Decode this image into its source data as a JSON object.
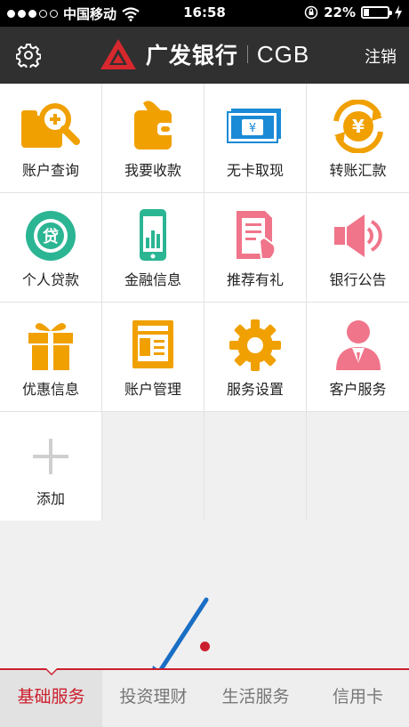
{
  "status": {
    "carrier": "中国移动",
    "time": "16:58",
    "battery": "22%",
    "battery_level": 0.22
  },
  "header": {
    "brand_cn": "广发银行",
    "brand_en": "CGB",
    "logout": "注销",
    "settings_icon": "gear-icon"
  },
  "grid": {
    "items": [
      {
        "label": "账户查询",
        "icon": "account-search-icon"
      },
      {
        "label": "我要收款",
        "icon": "wallet-icon"
      },
      {
        "label": "无卡取现",
        "icon": "cash-icon"
      },
      {
        "label": "转账汇款",
        "icon": "transfer-icon"
      },
      {
        "label": "个人贷款",
        "icon": "loan-icon"
      },
      {
        "label": "金融信息",
        "icon": "phone-chart-icon"
      },
      {
        "label": "推荐有礼",
        "icon": "recommend-icon"
      },
      {
        "label": "银行公告",
        "icon": "megaphone-icon"
      },
      {
        "label": "优惠信息",
        "icon": "gift-icon"
      },
      {
        "label": "账户管理",
        "icon": "id-card-icon"
      },
      {
        "label": "服务设置",
        "icon": "gear-icon"
      },
      {
        "label": "客户服务",
        "icon": "customer-service-icon"
      },
      {
        "label": "添加",
        "icon": "plus-icon"
      }
    ]
  },
  "tabs": [
    {
      "label": "基础服务",
      "active": true
    },
    {
      "label": "投资理财",
      "active": false
    },
    {
      "label": "生活服务",
      "active": false
    },
    {
      "label": "信用卡",
      "active": false
    }
  ],
  "colors": {
    "accent": "#cc1f2d",
    "orange": "#f0a000",
    "teal": "#2bb593",
    "pink": "#f0758a",
    "blue": "#1a8ad6"
  }
}
